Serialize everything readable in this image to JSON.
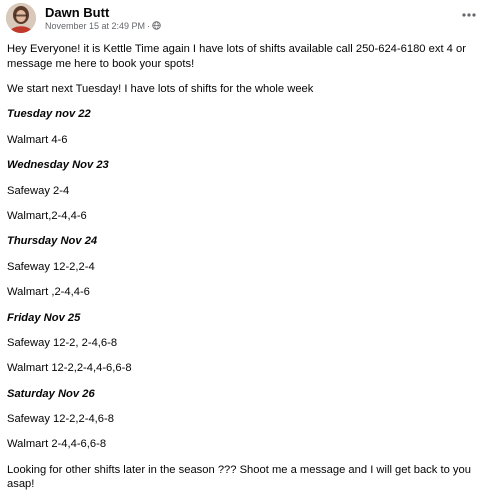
{
  "post": {
    "author": "Dawn Butt",
    "timestamp": "November 15 at 2:49 PM",
    "separator": "·",
    "audience_icon": "globe-icon",
    "more_icon": "more-options-icon",
    "lines": [
      {
        "text": "Hey Everyone! it is Kettle Time again I have lots of shifts available call 250-624-6180 ext 4 or message me here to book your spots!",
        "style": "normal"
      },
      {
        "text": "We start next Tuesday! I have lots of shifts for the whole week",
        "style": "normal"
      },
      {
        "text": "Tuesday nov 22",
        "style": "day"
      },
      {
        "text": "Walmart 4-6",
        "style": "normal"
      },
      {
        "text": "Wednesday Nov 23",
        "style": "day"
      },
      {
        "text": "Safeway 2-4",
        "style": "normal"
      },
      {
        "text": "Walmart,2-4,4-6",
        "style": "normal"
      },
      {
        "text": "Thursday Nov 24",
        "style": "day"
      },
      {
        "text": "Safeway 12-2,2-4",
        "style": "normal"
      },
      {
        "text": "Walmart ,2-4,4-6",
        "style": "normal"
      },
      {
        "text": "Friday Nov 25",
        "style": "day"
      },
      {
        "text": "Safeway 12-2, 2-4,6-8",
        "style": "normal"
      },
      {
        "text": "Walmart 12-2,2-4,4-6,6-8",
        "style": "normal"
      },
      {
        "text": "Saturday Nov 26",
        "style": "day"
      },
      {
        "text": "Safeway 12-2,2-4,6-8",
        "style": "normal"
      },
      {
        "text": "Walmart 2-4,4-6,6-8",
        "style": "normal"
      },
      {
        "text": "Looking for other shifts later in the season ??? Shoot me a message and I will get back to you asap!",
        "style": "normal"
      }
    ]
  }
}
